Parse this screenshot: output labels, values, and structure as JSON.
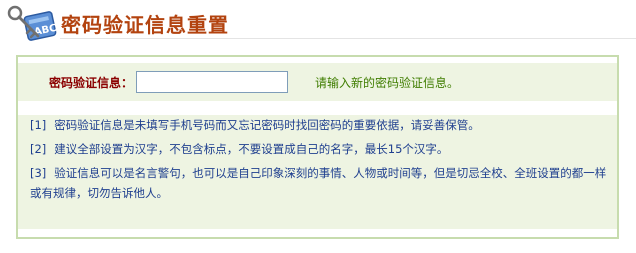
{
  "header": {
    "title": "密码验证信息重置",
    "logo_icon": "key-and-card-icon"
  },
  "form": {
    "label": "密码验证信息：",
    "input_value": "",
    "input_placeholder": "",
    "hint": "请输入新的密码验证信息。"
  },
  "notes": [
    {
      "num": "[1]",
      "text": "密码验证信息是未填写手机号码而又忘记密码时找回密码的重要依据，请妥善保管。"
    },
    {
      "num": "[2]",
      "text": "建议全部设置为汉字，不包含标点，不要设置成自己的名字，最长15个汉字。"
    },
    {
      "num": "[3]",
      "text": "验证信息可以是名言警句，也可以是自己印象深刻的事情、人物或时间等，但是切忌全校、全班设置的都一样或有规律，切勿告诉他人。"
    }
  ],
  "colors": {
    "title": "#b3430f",
    "label": "#8b0000",
    "hint": "#3f7d00",
    "notes": "#1f3f8f",
    "panel_border": "#c7dcae",
    "panel_fill": "#eef4e2"
  }
}
